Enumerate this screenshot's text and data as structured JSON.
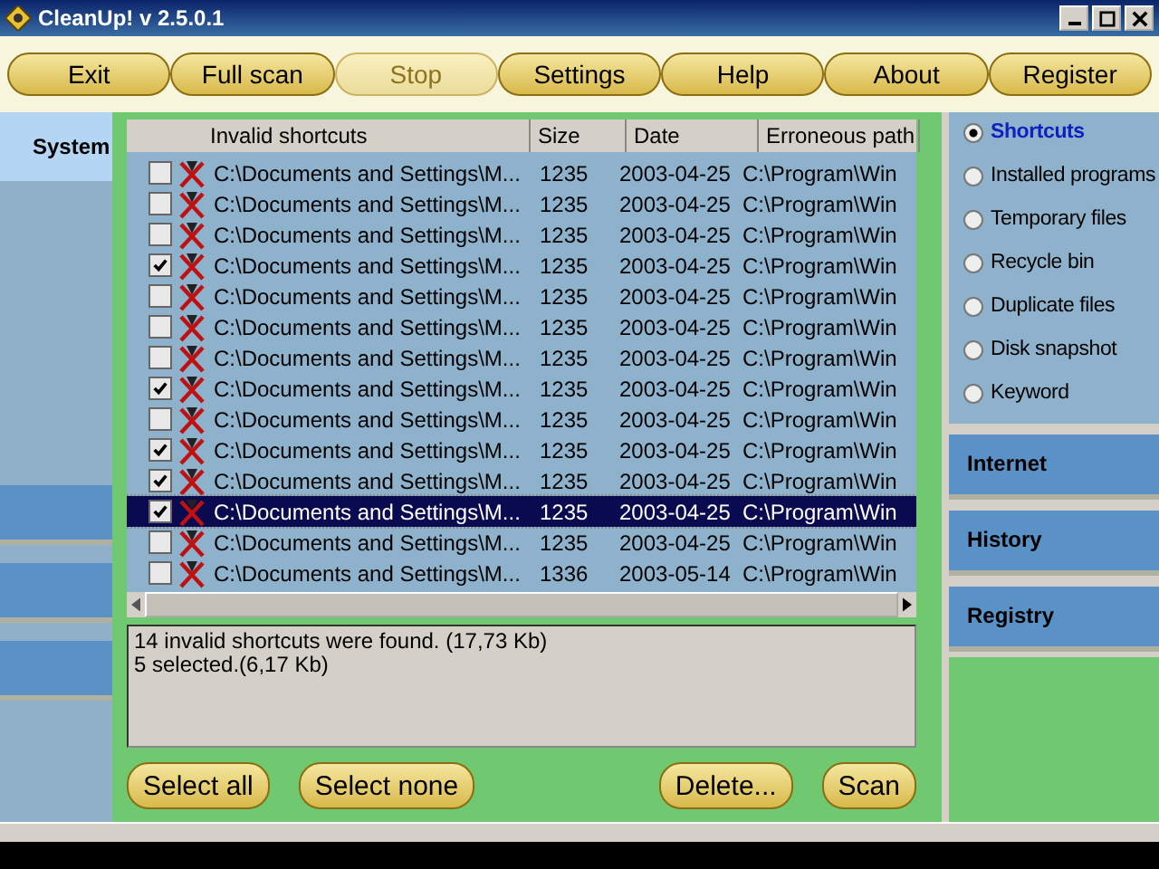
{
  "window": {
    "title": "CleanUp! v 2.5.0.1"
  },
  "toolbar": [
    {
      "label": "Exit",
      "disabled": false
    },
    {
      "label": "Full scan",
      "disabled": false
    },
    {
      "label": "Stop",
      "disabled": true
    },
    {
      "label": "Settings",
      "disabled": false
    },
    {
      "label": "Help",
      "disabled": false
    },
    {
      "label": "About",
      "disabled": false
    },
    {
      "label": "Register",
      "disabled": false
    }
  ],
  "left_panel": {
    "title": "System"
  },
  "table": {
    "columns": [
      "Invalid shortcuts",
      "Size",
      "Date",
      "Erroneous path"
    ],
    "rows": [
      {
        "path": "C:\\Documents and Settings\\M...",
        "size": "1235",
        "date": "2003-04-25",
        "target": "C:\\Program\\Win",
        "checked": false,
        "selected": false
      },
      {
        "path": "C:\\Documents and Settings\\M...",
        "size": "1235",
        "date": "2003-04-25",
        "target": "C:\\Program\\Win",
        "checked": false,
        "selected": false
      },
      {
        "path": "C:\\Documents and Settings\\M...",
        "size": "1235",
        "date": "2003-04-25",
        "target": "C:\\Program\\Win",
        "checked": false,
        "selected": false
      },
      {
        "path": "C:\\Documents and Settings\\M...",
        "size": "1235",
        "date": "2003-04-25",
        "target": "C:\\Program\\Win",
        "checked": true,
        "selected": false
      },
      {
        "path": "C:\\Documents and Settings\\M...",
        "size": "1235",
        "date": "2003-04-25",
        "target": "C:\\Program\\Win",
        "checked": false,
        "selected": false
      },
      {
        "path": "C:\\Documents and Settings\\M...",
        "size": "1235",
        "date": "2003-04-25",
        "target": "C:\\Program\\Win",
        "checked": false,
        "selected": false
      },
      {
        "path": "C:\\Documents and Settings\\M...",
        "size": "1235",
        "date": "2003-04-25",
        "target": "C:\\Program\\Win",
        "checked": false,
        "selected": false
      },
      {
        "path": "C:\\Documents and Settings\\M...",
        "size": "1235",
        "date": "2003-04-25",
        "target": "C:\\Program\\Win",
        "checked": true,
        "selected": false
      },
      {
        "path": "C:\\Documents and Settings\\M...",
        "size": "1235",
        "date": "2003-04-25",
        "target": "C:\\Program\\Win",
        "checked": false,
        "selected": false
      },
      {
        "path": "C:\\Documents and Settings\\M...",
        "size": "1235",
        "date": "2003-04-25",
        "target": "C:\\Program\\Win",
        "checked": true,
        "selected": false
      },
      {
        "path": "C:\\Documents and Settings\\M...",
        "size": "1235",
        "date": "2003-04-25",
        "target": "C:\\Program\\Win",
        "checked": true,
        "selected": false
      },
      {
        "path": "C:\\Documents and Settings\\M...",
        "size": "1235",
        "date": "2003-04-25",
        "target": "C:\\Program\\Win",
        "checked": true,
        "selected": true
      },
      {
        "path": "C:\\Documents and Settings\\M...",
        "size": "1235",
        "date": "2003-04-25",
        "target": "C:\\Program\\Win",
        "checked": false,
        "selected": false
      },
      {
        "path": "C:\\Documents and Settings\\M...",
        "size": "1336",
        "date": "2003-05-14",
        "target": "C:\\Program\\Win",
        "checked": false,
        "selected": false
      }
    ]
  },
  "summary": [
    "14 invalid shortcuts were found. (17,73 Kb)",
    "5 selected.(6,17 Kb)"
  ],
  "actions": {
    "left": [
      "Select all",
      "Select none"
    ],
    "right": [
      "Delete...",
      "Scan"
    ]
  },
  "scan_options": [
    {
      "label": "Shortcuts",
      "selected": true
    },
    {
      "label": "Installed programs",
      "selected": false
    },
    {
      "label": "Temporary files",
      "selected": false
    },
    {
      "label": "Recycle bin",
      "selected": false
    },
    {
      "label": "Duplicate files",
      "selected": false
    },
    {
      "label": "Disk snapshot",
      "selected": false
    },
    {
      "label": "Keyword",
      "selected": false
    }
  ],
  "categories": [
    "Internet",
    "History",
    "Registry"
  ]
}
